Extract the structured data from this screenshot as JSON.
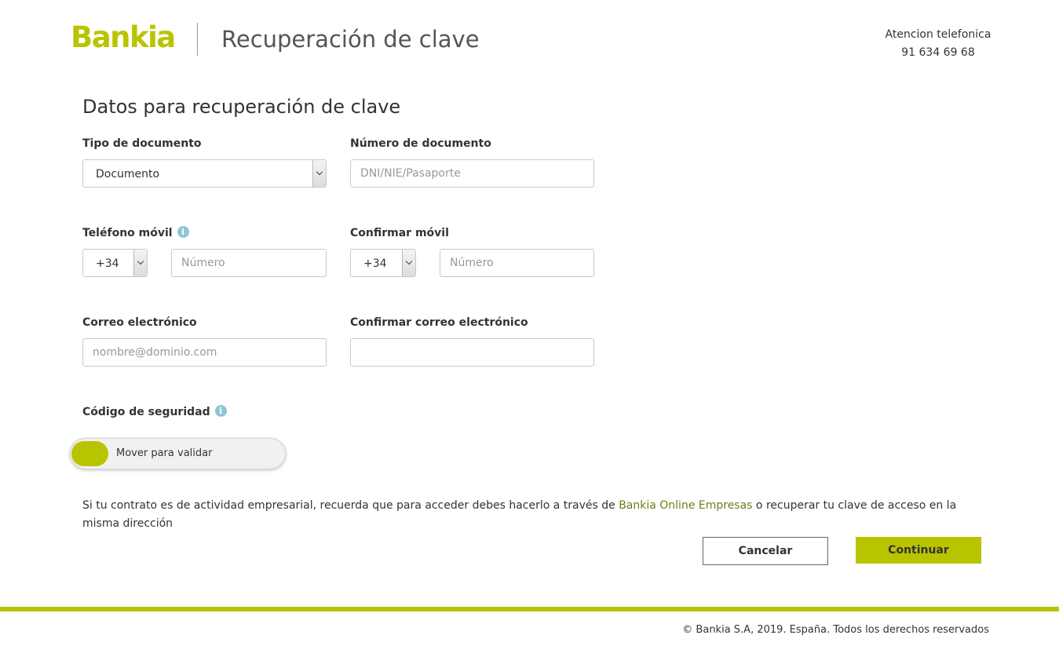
{
  "header": {
    "logo": "Bankia",
    "title": "Recuperación de clave",
    "phone_label": "Atencion telefonica",
    "phone_number": "91 634 69 68"
  },
  "form": {
    "title": "Datos para recuperación de clave",
    "doc_type": {
      "label": "Tipo de documento",
      "value": "Documento"
    },
    "doc_number": {
      "label": "Número de documento",
      "placeholder": "DNI/NIE/Pasaporte"
    },
    "mobile": {
      "label": "Teléfono móvil",
      "prefix": "+34",
      "placeholder": "Número"
    },
    "confirm_mobile": {
      "label": "Confirmar móvil",
      "prefix": "+34",
      "placeholder": "Número"
    },
    "email": {
      "label": "Correo electrónico",
      "placeholder": "nombre@dominio.com"
    },
    "confirm_email": {
      "label": "Confirmar correo electrónico",
      "placeholder": ""
    },
    "security_code": {
      "label": "Código de seguridad",
      "slider_label": "Mover para validar"
    }
  },
  "notice": {
    "text_before": "Si tu contrato es de actividad empresarial, recuerda que para acceder debes hacerlo a través de ",
    "link_text": "Bankia Online Empresas",
    "text_after": " o recuperar tu clave de acceso en la misma dirección"
  },
  "actions": {
    "cancel_label": "Cancelar",
    "continue_label": "Continuar"
  },
  "footer": {
    "copyright": "© Bankia S.A, 2019. España. Todos los derechos reservados"
  },
  "colors": {
    "brand": "#b8c400",
    "link": "#6f7d18",
    "info_icon": "#8ec5d6"
  },
  "icons": {
    "info": "info-circle-icon",
    "dropdown": "chevron-down-icon"
  }
}
